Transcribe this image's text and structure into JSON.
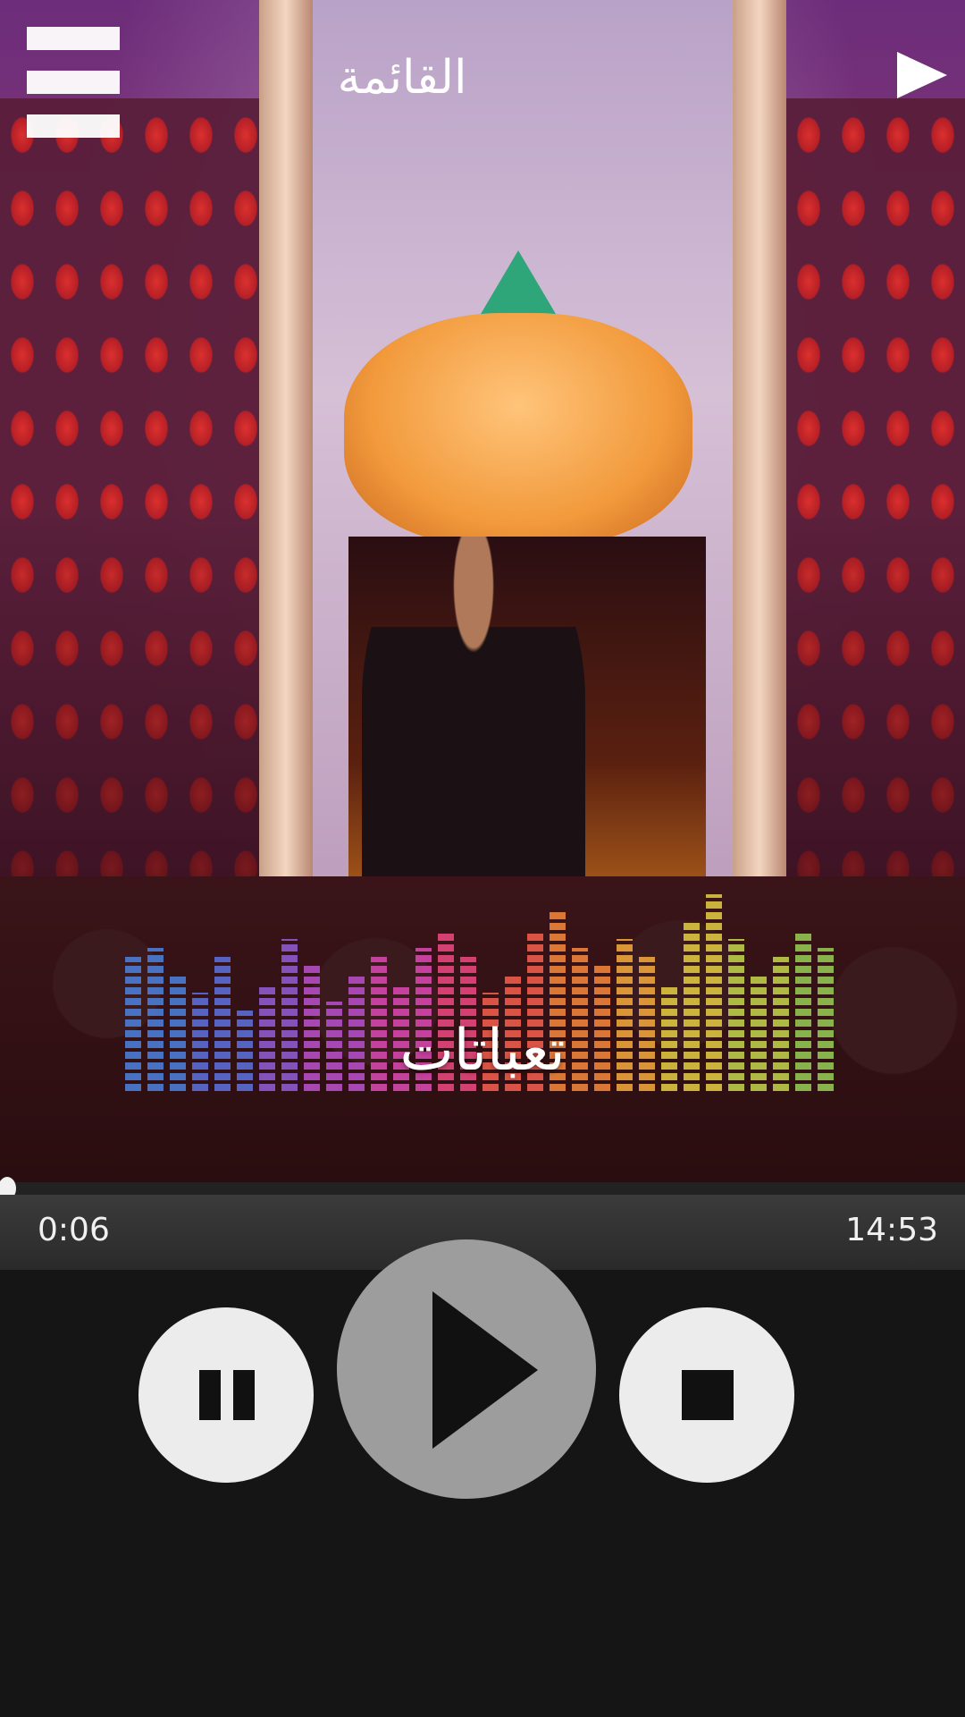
{
  "header": {
    "title": "القائمة",
    "menu_icon": "hamburger-menu-icon",
    "play_icon": "play-triangle-icon"
  },
  "now_playing": {
    "title": "تعباتات"
  },
  "playback": {
    "elapsed": "0:06",
    "duration": "14:53",
    "progress": 0.007
  },
  "controls": {
    "pause_icon": "pause-icon",
    "play_icon": "play-icon",
    "stop_icon": "stop-icon"
  },
  "colors": {
    "control_light": "#ececec",
    "control_play": "#9d9d9d",
    "background": "#151515"
  }
}
